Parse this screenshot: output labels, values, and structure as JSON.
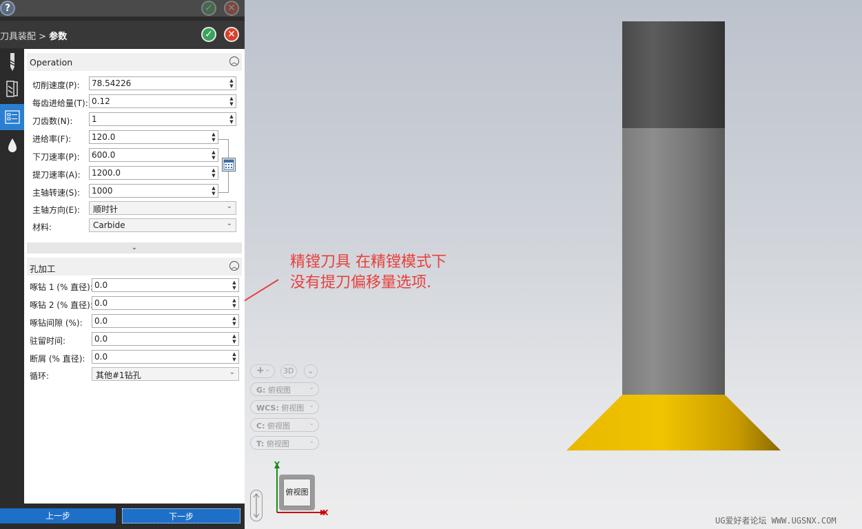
{
  "dialog": {
    "breadcrumb_parent": "刀具装配",
    "breadcrumb_sep": ">",
    "breadcrumb_current": "参数",
    "ok_glyph": "✓",
    "cancel_glyph": "✕",
    "help_glyph": "?"
  },
  "iconbar": {
    "items": [
      "drill-tool-icon",
      "tool-holder-icon",
      "parameters-icon",
      "coolant-icon"
    ],
    "active_index": 2,
    "accent_color": "#2a7fd0"
  },
  "operation": {
    "title": "Operation",
    "fields": [
      {
        "label": "切削速度(P):",
        "value": "78.54226"
      },
      {
        "label": "每齿进给量(T):",
        "value": "0.12"
      },
      {
        "label": "刀齿数(N):",
        "value": "1"
      },
      {
        "label": "进给率(F):",
        "value": "120.0"
      },
      {
        "label": "下刀速率(P):",
        "value": "600.0"
      },
      {
        "label": "提刀速率(A):",
        "value": "1200.0"
      },
      {
        "label": "主轴转速(S):",
        "value": "1000"
      }
    ],
    "direction_label": "主轴方向(E):",
    "direction_value": "顺时针",
    "material_label": "材料:",
    "material_value": "Carbide"
  },
  "hole": {
    "title": "孔加工",
    "fields": [
      {
        "label": "啄钻 1 (% 直径):",
        "value": "0.0"
      },
      {
        "label": "啄钻 2 (% 直径):",
        "value": "0.0"
      },
      {
        "label": "啄钻间隙 (%):",
        "value": "0.0"
      },
      {
        "label": "驻留时间:",
        "value": "0.0"
      },
      {
        "label": "断屑 (% 直径):",
        "value": "0.0"
      }
    ],
    "cycle_label": "循环:",
    "cycle_value": "其他#1钻孔"
  },
  "nav": {
    "prev": "上一步",
    "next": "下一步"
  },
  "viewport": {
    "annotation_line1": "精镗刀具 在精镗模式下",
    "annotation_line2": "没有提刀偏移量选项.",
    "annotation_color": "#e8403c",
    "view_3d": "3D",
    "g_label": "G:",
    "g_value": "俯视图",
    "wcs_label": "WCS:",
    "wcs_value": "俯视图",
    "c_label": "C:",
    "c_value": "俯视图",
    "t_label": "T:",
    "t_value": "俯视图",
    "cube_label": "俯视图",
    "axis_y": "Y",
    "axis_x": "X",
    "watermark": "UG爱好者论坛 WWW.UGSNX.COM",
    "tool_tip_color": "#f0c400"
  }
}
